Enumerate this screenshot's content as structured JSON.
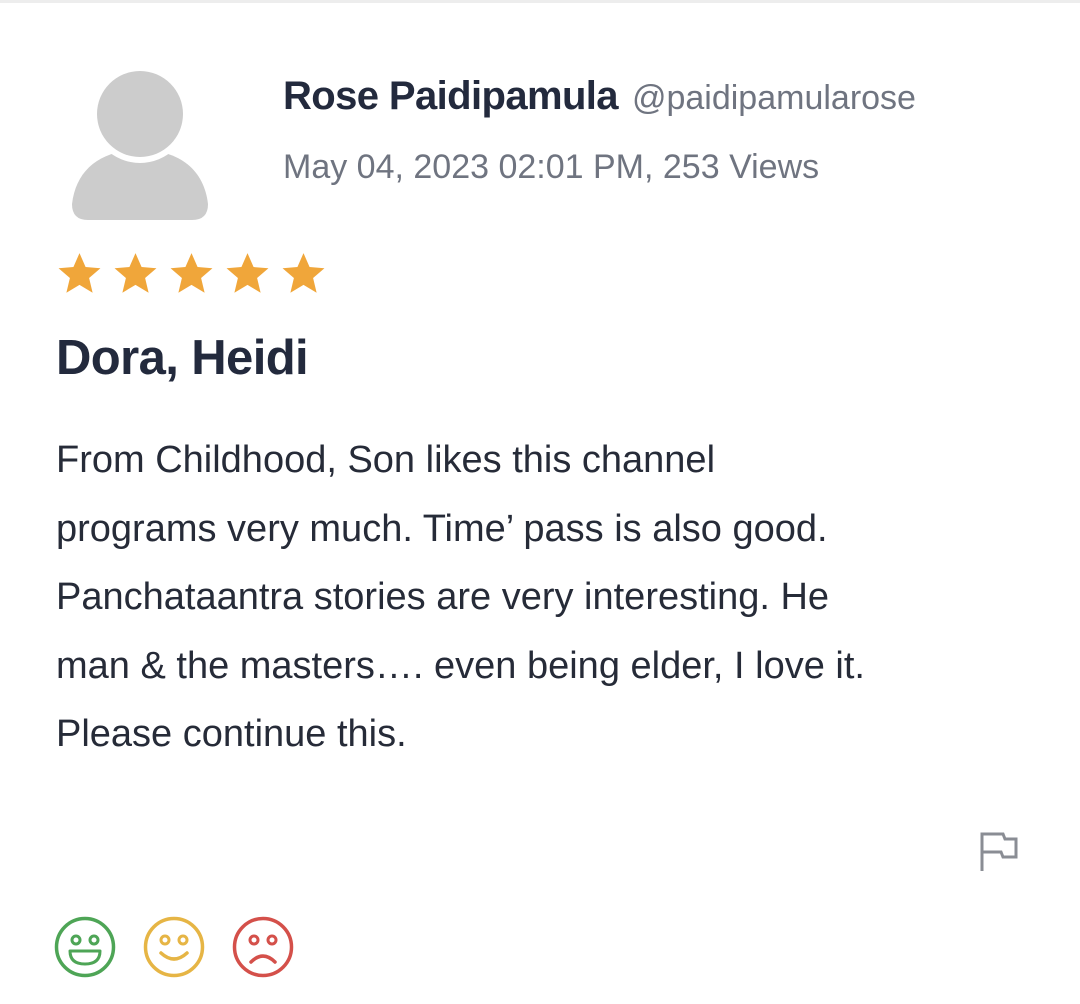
{
  "review": {
    "author": {
      "name": "Rose Paidipamula",
      "handle": "@paidipamularose",
      "avatar_icon": "default-user-avatar-icon"
    },
    "meta": "May 04, 2023 02:01 PM, 253 Views",
    "rating": 5,
    "rating_max": 5,
    "title": "Dora, Heidi",
    "body_lines": [
      "From Childhood, Son likes this channel",
      "programs very much. Time’ pass is also good.",
      "Panchataantra stories are very interesting. He",
      "man & the masters…. even being elder, I love it.",
      "Please continue this."
    ]
  },
  "actions": {
    "report_icon": "flag-icon",
    "reactions": [
      {
        "icon": "happy-face-icon",
        "color": "#4ea556"
      },
      {
        "icon": "neutral-smile-face-icon",
        "color": "#e6b545"
      },
      {
        "icon": "sad-face-icon",
        "color": "#d4504a"
      }
    ]
  },
  "colors": {
    "star": "#f0a63a",
    "title_text": "#232a3d",
    "meta_text": "#6f7480",
    "avatar": "#cccccc"
  }
}
